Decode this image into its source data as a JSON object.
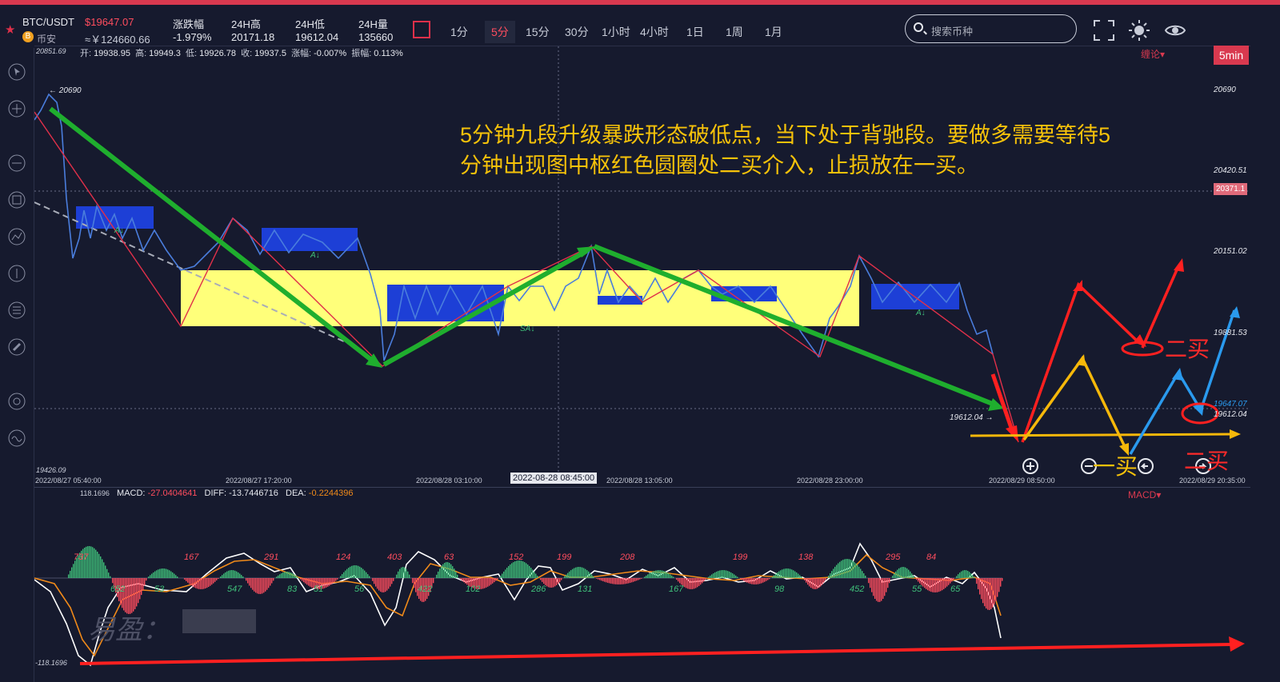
{
  "header": {
    "symbol": "BTC/USDT",
    "exchange": "币安",
    "coin_glyph": "B",
    "price": "$19647.07",
    "price_cny": "≈￥124660.66",
    "stats": [
      {
        "label": "涨跌幅",
        "value": "-1.979%"
      },
      {
        "label": "24H高",
        "value": "20171.18"
      },
      {
        "label": "24H低",
        "value": "19612.04"
      },
      {
        "label": "24H量",
        "value": "135660"
      }
    ],
    "periods": [
      "1分",
      "5分",
      "15分",
      "30分",
      "1小时",
      "4小时",
      "1日",
      "1周",
      "1月"
    ],
    "active_period": "5分",
    "search_placeholder": "搜索币种"
  },
  "chart": {
    "ohlc": {
      "open_label": "开:",
      "open": "19938.95",
      "high_label": "高:",
      "high": "19949.3",
      "low_label": "低:",
      "low": "19926.78",
      "close_label": "收:",
      "close": "19937.5",
      "chg_label": "涨幅:",
      "chg": "-0.007%",
      "amp_label": "振幅:",
      "amp": "0.113%"
    },
    "top_left_value": "20851.69",
    "bottom_left_value": "19426.09",
    "timeframe_badge": "5min",
    "indicator_link": "缠论▾",
    "y_labels": [
      "20690",
      "20420.51",
      "20151.02",
      "19881.53",
      "19647.07",
      "19612.04"
    ],
    "current_price_tag": "20371.1",
    "high_marker": "← 20690",
    "low_marker": "19612.04 →",
    "x_labels": [
      "2022/08/27 05:40:00",
      "2022/08/27 17:20:00",
      "2022/08/28 03:10:00",
      "2022/08/28 13:05:00",
      "2022/08/28 23:00:00",
      "2022/08/29 08:50:00",
      "2022/08/29 20:35:00"
    ],
    "cursor_time": "2022-08-28 08:45:00",
    "segment_labels": [
      "A↓",
      "A↓",
      "SA↓",
      "A↓"
    ],
    "annotation": "5分钟九段升级暴跌形态破低点，当下处于背驰段。要做多需要等待5分钟出现图中枢红色圆圈处二买介入，止损放在一买。",
    "tags": {
      "er_mai": "二买",
      "yi_mai": "一买"
    }
  },
  "macd": {
    "top_left": "118.1696",
    "bottom_left": "-118.1696",
    "macd_label": "MACD:",
    "macd": "-27.0404641",
    "diff_label": "DIFF:",
    "diff": "-13.7446716",
    "dea_label": "DEA:",
    "dea": "-0.2244396",
    "indicator_link": "MACD▾",
    "red_values": [
      "737",
      "167",
      "291",
      "124",
      "403",
      "63",
      "152",
      "199",
      "208",
      "199",
      "138",
      "295",
      "84"
    ],
    "green_values": [
      "652",
      "53",
      "547",
      "83",
      "51",
      "56",
      "422",
      "102",
      "286",
      "131",
      "167",
      "98",
      "452",
      "55",
      "65"
    ],
    "watermark": "易盈："
  },
  "colors": {
    "up": "#3fc07a",
    "down": "#ff4d5e",
    "accent": "#d9394f",
    "annotation": "#f6c20a",
    "zhongshu": "#ffff7a",
    "pivot": "#1d3fd6"
  }
}
